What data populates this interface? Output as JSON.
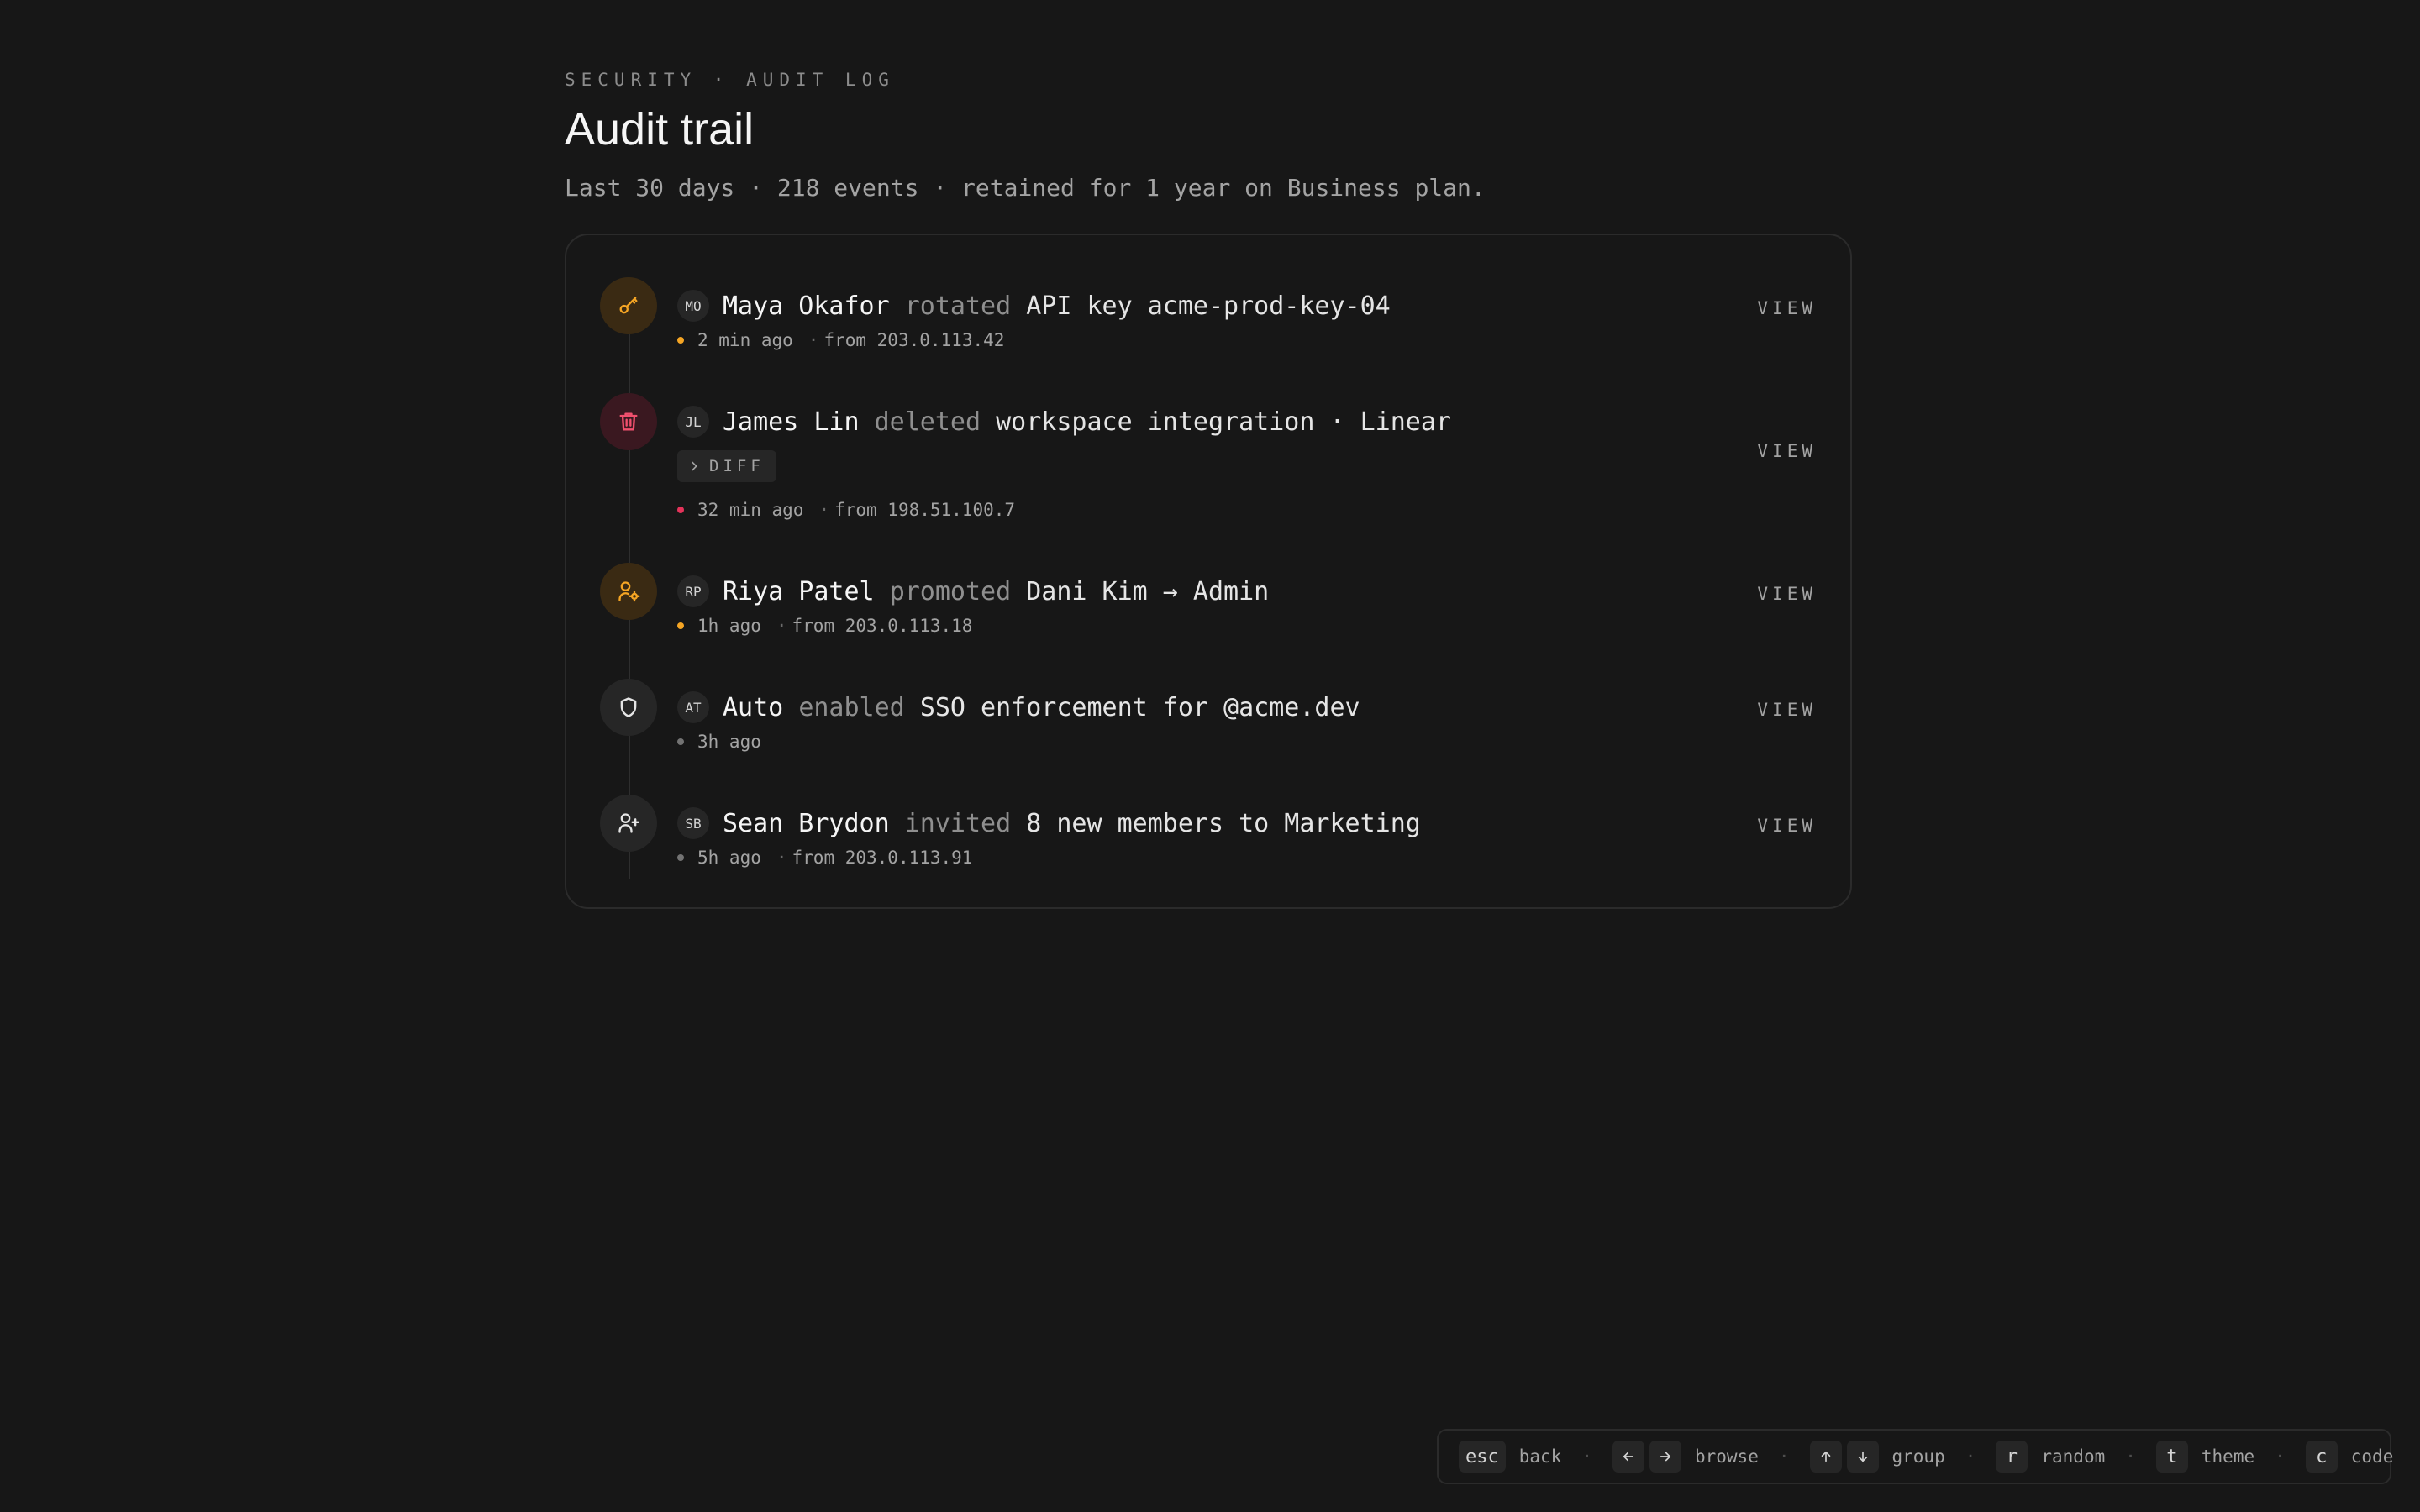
{
  "header": {
    "eyebrow": "SECURITY · AUDIT LOG",
    "title": "Audit trail",
    "subtitle": "Last 30 days · 218 events · retained for 1 year on Business plan."
  },
  "events": [
    {
      "icon": "key-icon",
      "tone": "amber",
      "initials": "MO",
      "actor": "Maya Okafor",
      "verb": "rotated",
      "target": "API key acme-prod-key-04",
      "time": "2 min ago",
      "source": "from 203.0.113.42",
      "view_label": "VIEW"
    },
    {
      "icon": "trash-icon",
      "tone": "red",
      "initials": "JL",
      "actor": "James Lin",
      "verb": "deleted",
      "target": "workspace integration · Linear",
      "diff_label": "DIFF",
      "time": "32 min ago",
      "source": "from 198.51.100.7",
      "view_label": "VIEW"
    },
    {
      "icon": "user-cog-icon",
      "tone": "amber",
      "initials": "RP",
      "actor": "Riya Patel",
      "verb": "promoted",
      "target": "Dani Kim → Admin",
      "time": "1h ago",
      "source": "from 203.0.113.18",
      "view_label": "VIEW"
    },
    {
      "icon": "shield-icon",
      "tone": "gray",
      "initials": "AT",
      "actor": "Auto",
      "verb": "enabled",
      "target": "SSO enforcement for @acme.dev",
      "time": "3h ago",
      "view_label": "VIEW"
    },
    {
      "icon": "user-plus-icon",
      "tone": "gray",
      "initials": "SB",
      "actor": "Sean Brydon",
      "verb": "invited",
      "target": "8 new members to Marketing",
      "time": "5h ago",
      "source": "from 203.0.113.91",
      "view_label": "VIEW"
    }
  ],
  "shortcuts": {
    "esc": {
      "key": "esc",
      "label": "back"
    },
    "browse": {
      "keys": [
        "arrow-left-icon",
        "arrow-right-icon"
      ],
      "label": "browse"
    },
    "group": {
      "keys": [
        "arrow-up-icon",
        "arrow-down-icon"
      ],
      "label": "group"
    },
    "random": {
      "key": "r",
      "label": "random"
    },
    "theme": {
      "key": "t",
      "label": "theme"
    },
    "code": {
      "key": "c",
      "label": "code"
    },
    "separator": "·"
  },
  "colors": {
    "background": "#171717",
    "amber": "#f5a524",
    "red": "#e5335a",
    "muted": "#8f8f8f"
  }
}
